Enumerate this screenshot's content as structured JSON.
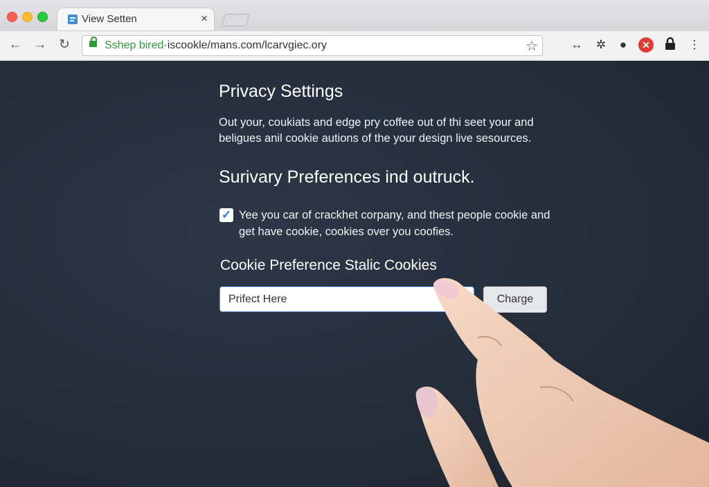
{
  "browser": {
    "tab_title": "View Setten",
    "tab_close": "×",
    "url_secure": "Sshep bired",
    "url_rest": "·iscookle/mans.com/lcarvgiec.ory",
    "icons": [
      "back-icon",
      "forward-icon",
      "reload-icon",
      "lock-icon",
      "star-icon",
      "resize-icon",
      "extension-icon",
      "search-icon",
      "error-icon",
      "padlock-icon",
      "menu-icon"
    ]
  },
  "page": {
    "title": "Privacy Settings",
    "intro": "Out your, coukiats and edge pry coffee out of thi seet your and beligues anil cookie autions of the your design live sesources.",
    "subhead": "Surivary Preferences ind outruck.",
    "consent_checked": true,
    "consent_text": "Yee you car of crackhet corpany, and thest people cookie and get have cookie, cookies over you coofies.",
    "section_title": "Cookie Preference Stalic Cookies",
    "input_value": "Prifect Here",
    "button_label": "Charge"
  },
  "colors": {
    "page_bg": "#262f3d",
    "secure_green": "#2a9d3b",
    "checkbox_accent": "#2a78d6",
    "input_focus": "#5a9be6",
    "error_red": "#e53935"
  }
}
